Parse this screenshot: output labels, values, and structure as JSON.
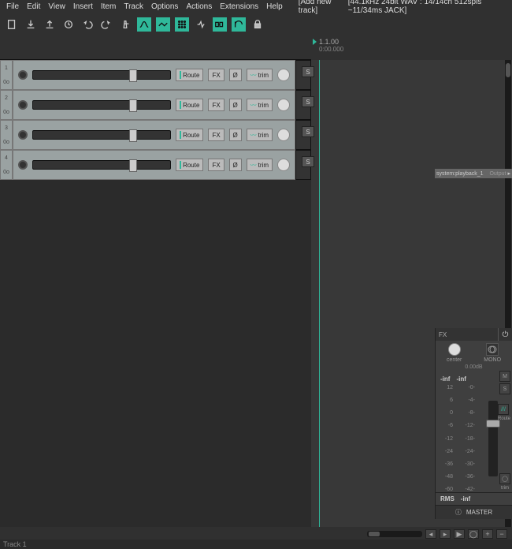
{
  "menu": {
    "file": "File",
    "edit": "Edit",
    "view": "View",
    "insert": "Insert",
    "item": "Item",
    "track": "Track",
    "options": "Options",
    "actions": "Actions",
    "extensions": "Extensions",
    "help": "Help",
    "addnew": "[Add new track]"
  },
  "header_status": "[44.1kHz 24bit WAV : 14/14ch 512spls ~11/34ms JACK]",
  "ruler": {
    "bbt": "1.1.00",
    "tc": "0:00.000"
  },
  "tracks": [
    {
      "num": "1",
      "io": "0o",
      "route": "Route",
      "fx": "FX",
      "inv": "Ø",
      "trim": "trim"
    },
    {
      "num": "2",
      "io": "0o",
      "route": "Route",
      "fx": "FX",
      "inv": "Ø",
      "trim": "trim"
    },
    {
      "num": "3",
      "io": "0o",
      "route": "Route",
      "fx": "FX",
      "inv": "Ø",
      "trim": "trim"
    },
    {
      "num": "4",
      "io": "0o",
      "route": "Route",
      "fx": "FX",
      "inv": "Ø",
      "trim": "trim"
    }
  ],
  "solo_label": "S",
  "route_strip": {
    "label": "system:playback_1",
    "sub": "Output"
  },
  "master": {
    "fx": "FX",
    "center": "center",
    "mono": "MONO",
    "db": "0.00dB",
    "m": "M",
    "s": "S",
    "inf1": "-inf",
    "inf2": "-inf",
    "scale_l": [
      "12",
      "6",
      "0",
      "-6",
      "-12",
      "-24",
      "-36",
      "-48",
      "-60"
    ],
    "scale_r": [
      "-0-",
      "-4-",
      "-8-",
      "-12-",
      "-18-",
      "-24-",
      "-30-",
      "-36-",
      "-42-"
    ],
    "rms": "RMS",
    "inf3": "-inf",
    "route": "Route",
    "trim": "trim",
    "title": "MASTER",
    "info_i": "ⓘ",
    "pwr": "⏻"
  },
  "zoom": {
    "plus": "+",
    "minus": "−",
    "circ": "◯",
    "play": "▶"
  },
  "status_text": "Track 1",
  "icons": {
    "chev": "▸",
    "x": "×",
    "diag": "///"
  }
}
